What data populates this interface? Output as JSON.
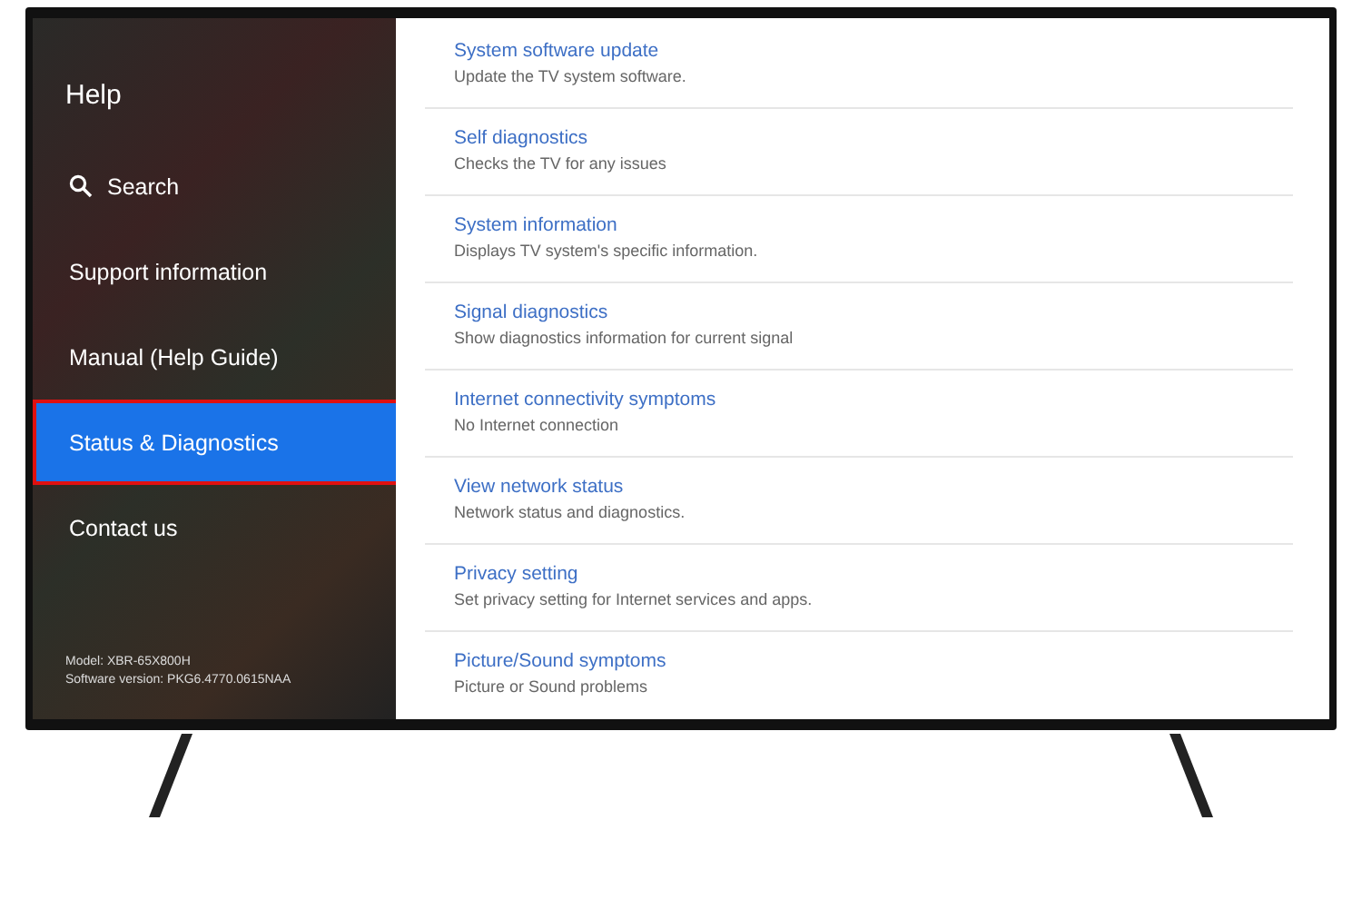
{
  "sidebar": {
    "title": "Help",
    "items": [
      {
        "label": "Search",
        "kind": "search",
        "selected": false
      },
      {
        "label": "Support information",
        "kind": "plain",
        "selected": false
      },
      {
        "label": "Manual (Help Guide)",
        "kind": "plain",
        "selected": false
      },
      {
        "label": "Status & Diagnostics",
        "kind": "plain",
        "selected": true
      },
      {
        "label": "Contact us",
        "kind": "plain",
        "selected": false
      }
    ],
    "model": "Model: XBR-65X800H",
    "software_version": "Software version: PKG6.4770.0615NAA"
  },
  "menu": [
    {
      "title": "System software update",
      "description": "Update the TV system software."
    },
    {
      "title": "Self diagnostics",
      "description": "Checks the TV for any issues"
    },
    {
      "title": "System information",
      "description": "Displays TV system's specific information."
    },
    {
      "title": "Signal diagnostics",
      "description": "Show diagnostics information for current signal"
    },
    {
      "title": "Internet connectivity symptoms",
      "description": "No Internet connection"
    },
    {
      "title": "View network status",
      "description": "Network status and diagnostics."
    },
    {
      "title": "Privacy setting",
      "description": "Set privacy setting for Internet services and apps."
    },
    {
      "title": "Picture/Sound symptoms",
      "description": "Picture or Sound problems"
    }
  ]
}
